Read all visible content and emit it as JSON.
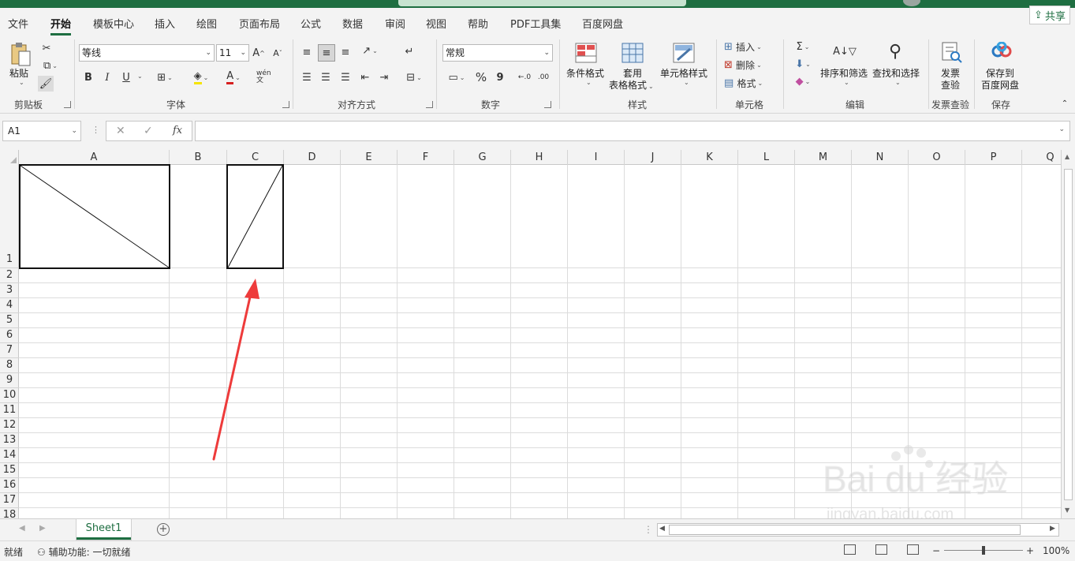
{
  "tabs": [
    "文件",
    "开始",
    "模板中心",
    "插入",
    "绘图",
    "页面布局",
    "公式",
    "数据",
    "审阅",
    "视图",
    "帮助",
    "PDF工具集",
    "百度网盘"
  ],
  "active_tab": "开始",
  "share_label": "共享",
  "ribbon": {
    "clipboard": {
      "paste": "粘贴",
      "group": "剪贴板"
    },
    "font": {
      "name": "等线",
      "size": "11",
      "bold": "B",
      "italic": "I",
      "underline": "U",
      "grow": "A",
      "shrink": "A",
      "group": "字体",
      "wen": "wén 文"
    },
    "alignment": {
      "group": "对齐方式"
    },
    "number": {
      "format": "常规",
      "percent": "%",
      "comma": "9",
      "group": "数字"
    },
    "styles": {
      "conditional": "条件格式",
      "table_line1": "套用",
      "table_line2": "表格格式",
      "cell_styles": "单元格样式",
      "group": "样式"
    },
    "cells": {
      "insert": "插入",
      "delete": "删除",
      "format": "格式",
      "group": "单元格"
    },
    "editing": {
      "sort": "排序和筛选",
      "find": "查找和选择",
      "group": "编辑"
    },
    "invoice": {
      "line1": "发票",
      "line2": "查验",
      "group": "发票查验"
    },
    "save": {
      "line1": "保存到",
      "line2": "百度网盘",
      "group": "保存"
    }
  },
  "namebox": "A1",
  "fx_label": "fx",
  "columns": [
    "A",
    "B",
    "C",
    "D",
    "E",
    "F",
    "G",
    "H",
    "I",
    "J",
    "K",
    "L",
    "M",
    "N",
    "O",
    "P",
    "Q"
  ],
  "rows": [
    "1",
    "2",
    "3",
    "4",
    "5",
    "6",
    "7",
    "8",
    "9",
    "10",
    "11",
    "12",
    "13",
    "14",
    "15",
    "16",
    "17",
    "18"
  ],
  "sheet_tab": "Sheet1",
  "status": {
    "ready": "就绪",
    "accessibility": "辅助功能: 一切就绪",
    "zoom": "100%"
  },
  "watermark": {
    "logo": "Bai du 经验",
    "url": "jingyan.baidu.com"
  },
  "colors": {
    "accent": "#1e6e41",
    "arrow": "#ee3b3b",
    "grid": "#dcdcdc"
  }
}
